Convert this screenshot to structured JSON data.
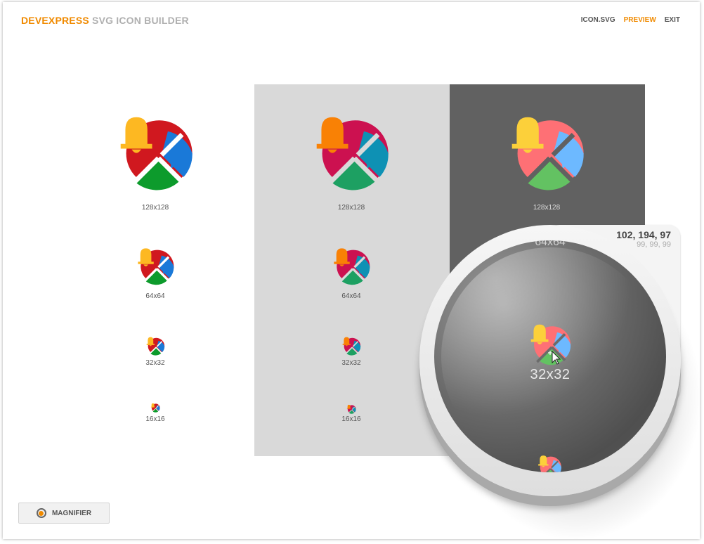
{
  "app": {
    "brand_part1": "DEVEXPRESS",
    "brand_part2": "SVG ICON BUILDER"
  },
  "nav": {
    "items": [
      "ICON.SVG",
      "PREVIEW",
      "EXIT"
    ],
    "active": "PREVIEW"
  },
  "sizes": [
    "128x128",
    "64x64",
    "32x32",
    "16x16"
  ],
  "columns": {
    "white": {
      "background": "#ffffff",
      "bell": "#fdb822",
      "red": "#d0181f",
      "blue": "#1a79d8",
      "green": "#0d9b2c"
    },
    "light": {
      "background": "#d9d9d9",
      "bell": "#f98105",
      "red": "#cc1150",
      "blue": "#0e91b4",
      "green": "#1da062"
    },
    "dark": {
      "background": "#616161",
      "bell": "#fcd03a",
      "red": "#fe7075",
      "blue": "#6db9ff",
      "green": "#63c262"
    }
  },
  "magnifier": {
    "label": "32x32",
    "label_top": "64x64",
    "rgb": "102, 194, 97",
    "background_rgb": "99, 99, 99"
  },
  "magnifier_button": {
    "label": "MAGNIFIER",
    "icon": "magnifier-icon"
  }
}
